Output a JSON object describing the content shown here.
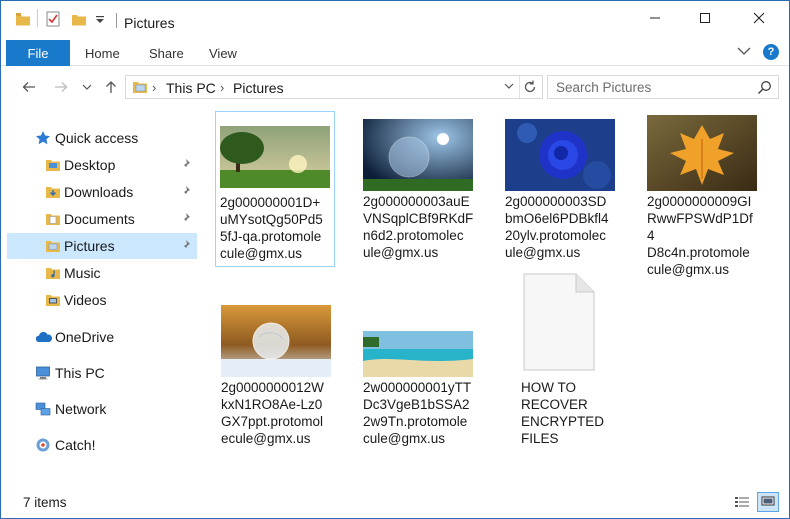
{
  "window": {
    "title": "Pictures"
  },
  "ribbon": {
    "file": "File",
    "tabs": [
      "Home",
      "Share",
      "View"
    ],
    "help": "?"
  },
  "address": {
    "crumbs": [
      "This PC",
      "Pictures"
    ],
    "separator": "›",
    "search_placeholder": "Search Pictures"
  },
  "sidebar": {
    "items": [
      {
        "label": "Quick access",
        "icon": "star-icon",
        "pinned": false
      },
      {
        "label": "Desktop",
        "icon": "desktop-folder-icon",
        "pinned": true
      },
      {
        "label": "Downloads",
        "icon": "downloads-folder-icon",
        "pinned": true
      },
      {
        "label": "Documents",
        "icon": "documents-folder-icon",
        "pinned": true
      },
      {
        "label": "Pictures",
        "icon": "pictures-folder-icon",
        "pinned": true,
        "selected": true
      },
      {
        "label": "Music",
        "icon": "music-folder-icon",
        "pinned": false
      },
      {
        "label": "Videos",
        "icon": "videos-folder-icon",
        "pinned": false
      },
      {
        "label": "OneDrive",
        "icon": "cloud-icon",
        "pinned": false
      },
      {
        "label": "This PC",
        "icon": "computer-icon",
        "pinned": false
      },
      {
        "label": "Network",
        "icon": "network-icon",
        "pinned": false
      },
      {
        "label": "Catch!",
        "icon": "catch-icon",
        "pinned": false
      }
    ]
  },
  "files": [
    {
      "name": "2g000000001D+uMYsotQg50Pd55fJ-qa.protomolecule@gmx.us",
      "lines": [
        "2g000000001D+",
        "uMYsotQg50Pd5",
        "5fJ-qa.protomole",
        "cule@gmx.us"
      ],
      "thumb": "tree-meadow-thumbnail"
    },
    {
      "name": "2g000000003auEVNSqplCBf9RKdFn6d2.protomolecule@gmx.us",
      "lines": [
        "2g000000003auE",
        "VNSqplCBf9RKdF",
        "n6d2.protomolec",
        "ule@gmx.us"
      ],
      "thumb": "bubble-night-thumbnail"
    },
    {
      "name": "2g000000003SDbmO6el6PDBkfl420ylv.protomolecule@gmx.us",
      "lines": [
        "2g000000003SD",
        "bmO6el6PDBkfl4",
        "20ylv.protomolec",
        "ule@gmx.us"
      ],
      "thumb": "blue-rose-thumbnail"
    },
    {
      "name": "2g0000000009GIRwwFPSWdP1Df4D8c4n.protomolecule@gmx.us",
      "lines": [
        "2g0000000009GI",
        "RwwFPSWdP1Df4",
        "D8c4n.protomole",
        "cule@gmx.us"
      ],
      "thumb": "autumn-leaf-thumbnail"
    },
    {
      "name": "2g0000000012WkxN1RO8Ae-Lz0GX7ppt.protomolecule@gmx.us",
      "lines": [
        "2g0000000012W",
        "kxN1RO8Ae-Lz0",
        "GX7ppt.protomol",
        "ecule@gmx.us"
      ],
      "thumb": "frozen-bubble-thumbnail"
    },
    {
      "name": "2w000000001yTTDc3VgeB1bSSA22w9Tn.protomolecule@gmx.us",
      "lines": [
        "2w000000001yTT",
        "Dc3VgeB1bSSA2",
        "2w9Tn.protomole",
        "cule@gmx.us"
      ],
      "thumb": "beach-thumbnail"
    },
    {
      "name": "HOW TO RECOVER ENCRYPTED FILES",
      "lines": [
        "HOW TO",
        "RECOVER",
        "ENCRYPTED",
        "FILES"
      ],
      "thumb": "blank-document-icon"
    }
  ],
  "status": {
    "item_count": "7 items"
  },
  "colors": {
    "accent": "#1979ca",
    "selection": "#cce8ff",
    "folder": "#e8b84a"
  }
}
